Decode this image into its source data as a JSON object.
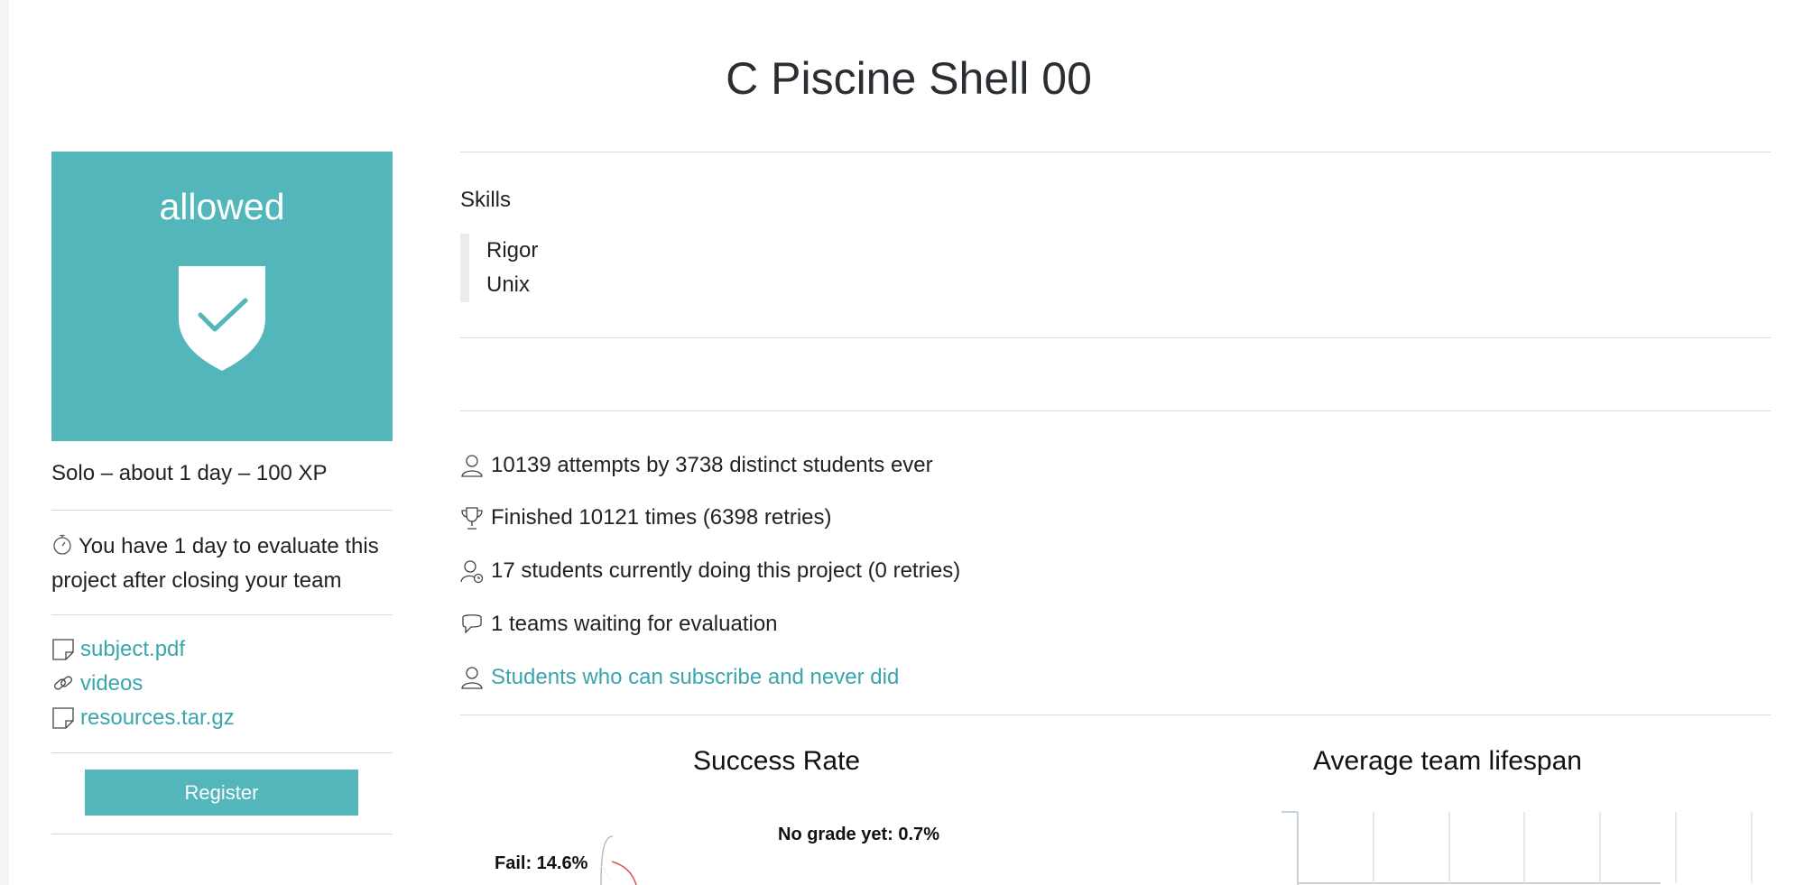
{
  "page": {
    "title": "C Piscine Shell 00"
  },
  "status": {
    "label": "allowed",
    "icon": "shield-check-icon",
    "color": "#52b6bb"
  },
  "meta": {
    "summary": "Solo – about 1 day – 100 XP"
  },
  "evaluation_note": {
    "icon": "stopwatch-icon",
    "text": "You have 1 day to evaluate this project after closing your team"
  },
  "attachments": [
    {
      "icon": "file-icon",
      "label": "subject.pdf"
    },
    {
      "icon": "link-icon",
      "label": "videos"
    },
    {
      "icon": "file-icon",
      "label": "resources.tar.gz"
    }
  ],
  "register_button": {
    "label": "Register"
  },
  "skills": {
    "title": "Skills",
    "items": [
      "Rigor",
      "Unix"
    ]
  },
  "stats": [
    {
      "icon": "user-icon",
      "text": "10139 attempts by 3738 distinct students ever"
    },
    {
      "icon": "trophy-icon",
      "text": "Finished 10121 times (6398 retries)"
    },
    {
      "icon": "user-clock-icon",
      "text": "17 students currently doing this project (0 retries)"
    },
    {
      "icon": "chat-icon",
      "text": "1 teams waiting for evaluation"
    },
    {
      "icon": "user-icon",
      "text": "Students who can subscribe and never did"
    }
  ],
  "charts": {
    "success_rate": {
      "title": "Success Rate"
    },
    "team_lifespan": {
      "title": "Average team lifespan"
    }
  },
  "chart_data": [
    {
      "type": "pie",
      "title": "Success Rate",
      "labels": [
        "Fail",
        "No grade yet"
      ],
      "values": [
        14.6,
        0.7
      ],
      "unit": "%"
    },
    {
      "type": "bar",
      "title": "Average team lifespan",
      "categories": [],
      "values": []
    }
  ],
  "colors": {
    "accent": "#52b6bb",
    "link": "#3aa5ad",
    "fail": "#d9534f"
  }
}
